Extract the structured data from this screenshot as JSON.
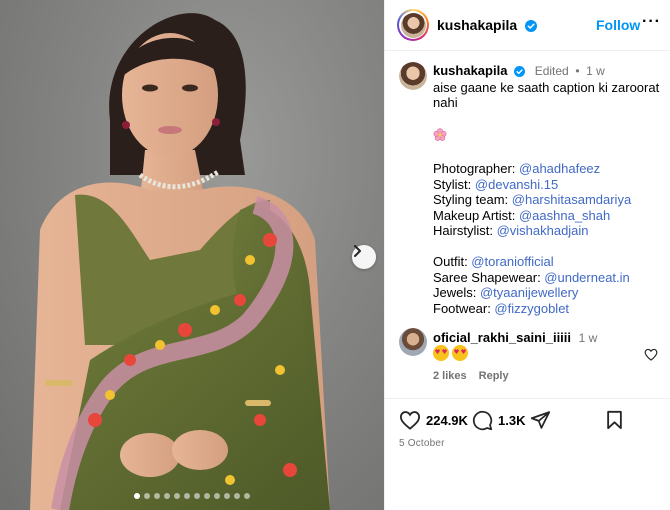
{
  "post": {
    "username": "kushakapila",
    "follow_label": "Follow",
    "more_label": "···",
    "edited_label": "Edited",
    "separator": "•",
    "caption_time": "1 w",
    "caption_lines": [
      "aise gaane ke saath caption ki zaroorat",
      "nahi"
    ],
    "credits": [
      {
        "label": "Photographer: ",
        "handle": "@ahadhafeez"
      },
      {
        "label": "Stylist: ",
        "handle": "@devanshi.15"
      },
      {
        "label": "Styling team: ",
        "handle": "@harshitasamdariya"
      },
      {
        "label": "Makeup Artist: ",
        "handle": "@aashna_shah"
      },
      {
        "label": "Hairstylist: ",
        "handle": "@vishakhadjain"
      }
    ],
    "outfit_credits": [
      {
        "label": "Outfit: ",
        "handle": "@toraniofficial"
      },
      {
        "label": "Saree Shapewear: ",
        "handle": "@underneat.in"
      },
      {
        "label": "Jewels: ",
        "handle": "@tyaanijewellery"
      },
      {
        "label": "Footwear: ",
        "handle": "@fizzygoblet"
      }
    ]
  },
  "comment": {
    "username": "oficial_rakhi_saini_iiiii",
    "time": "1 w",
    "likes": "2 likes",
    "reply": "Reply"
  },
  "stats": {
    "likes": "224.9K",
    "comments": "1.3K",
    "date": "5 October"
  },
  "carousel": {
    "total": 12,
    "active": 1
  },
  "icons": {
    "verified": "verified-badge-icon",
    "heart": "heart-icon",
    "comment": "comment-icon",
    "share": "share-icon",
    "save": "bookmark-icon",
    "next": "chevron-right-icon"
  },
  "colors": {
    "accent": "#0095f6",
    "link": "#4169c6",
    "muted": "#737373"
  }
}
